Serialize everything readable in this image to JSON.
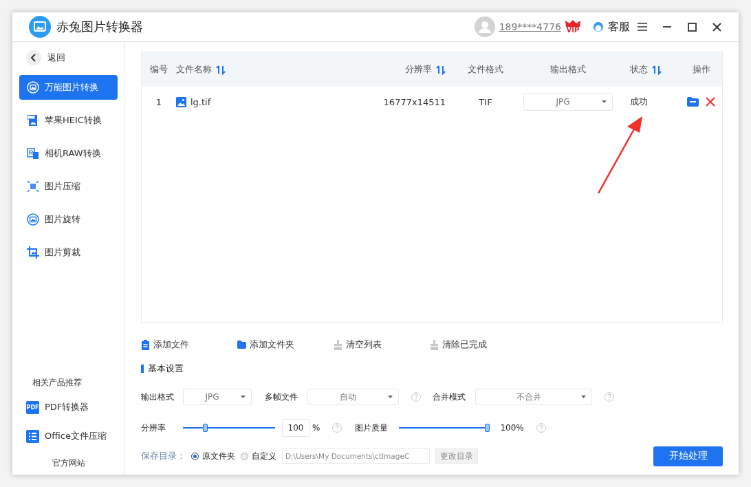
{
  "window": {
    "title": "赤兔图片转换器"
  },
  "account": {
    "user": "189****4776",
    "vip_badge": "VIP",
    "service": "客服"
  },
  "sidebar": {
    "back": "返回",
    "items": [
      {
        "label": "万能图片转换",
        "selected": true
      },
      {
        "label": "苹果HEIC转换",
        "selected": false
      },
      {
        "label": "相机RAW转换",
        "selected": false
      },
      {
        "label": "图片压缩",
        "selected": false
      },
      {
        "label": "图片旋转",
        "selected": false
      },
      {
        "label": "图片剪裁",
        "selected": false
      }
    ],
    "related_heading": "相关产品推荐",
    "related": [
      {
        "label": "PDF转换器",
        "icon_text": "PDF"
      },
      {
        "label": "Office文件压缩"
      }
    ],
    "website": "官方网站"
  },
  "table": {
    "columns": [
      {
        "label": "编号",
        "sortable": false
      },
      {
        "label": "文件名称",
        "sortable": true
      },
      {
        "label": "分辨率",
        "sortable": true
      },
      {
        "label": "文件格式",
        "sortable": false
      },
      {
        "label": "输出格式",
        "sortable": false
      },
      {
        "label": "状态",
        "sortable": true
      },
      {
        "label": "操作",
        "sortable": false
      }
    ],
    "rows": [
      {
        "number": "1",
        "file": "lg.tif",
        "resolution": "16777x14511",
        "format": "TIF",
        "output": "JPG",
        "status": "成功"
      }
    ]
  },
  "actions": [
    {
      "label": "添加文件",
      "disabled": false
    },
    {
      "label": "添加文件夹",
      "disabled": false
    },
    {
      "label": "清空列表",
      "disabled": true
    },
    {
      "label": "清除已完成",
      "disabled": true
    }
  ],
  "settings": {
    "heading": "基本设置",
    "output_format": {
      "label": "输出格式",
      "value": "JPG"
    },
    "multi_frame": {
      "label": "多帧文件",
      "value": "自动"
    },
    "merge_mode": {
      "label": "合并模式",
      "value": "不合并"
    },
    "resolution": {
      "label": "分辨率",
      "level": 0.23,
      "value": "100",
      "unit": "%"
    },
    "quality": {
      "label": "图片质量",
      "level": 1,
      "reading": "100%"
    },
    "save": {
      "label": "保存目录：",
      "options": [
        {
          "label": "原文件夹",
          "selected": true
        },
        {
          "label": "自定义",
          "selected": false
        }
      ],
      "path": "D:\\Users\\My Documents\\ctImageC",
      "change": "更改目录"
    },
    "start": "开始处理"
  }
}
